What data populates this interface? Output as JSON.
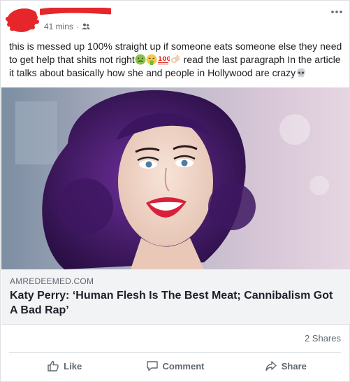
{
  "post": {
    "timestamp": "41 mins",
    "separator": "·",
    "privacy_icon": "friends-icon",
    "text_parts": {
      "part1": "this is messed up 100% straight up if someone eats someone else they need to get help that shits not right",
      "part2": " read the last paragraph In the article it talks about basically how she and people in Hollywood are crazy"
    },
    "emojis": [
      "nauseated-face-icon",
      "vomiting-face-icon",
      "hundred-points-icon",
      "ok-hand-icon",
      "skull-icon"
    ]
  },
  "link_preview": {
    "domain": "AMREDEEMED.COM",
    "title": "Katy Perry: ‘Human Flesh Is The Best Meat; Cannibalism Got A Bad Rap’"
  },
  "engagement": {
    "shares": "2 Shares"
  },
  "actions": {
    "like": "Like",
    "comment": "Comment",
    "share": "Share"
  },
  "colors": {
    "redaction": "#e5262a",
    "link_bg": "#f2f3f5",
    "muted_text": "#606770",
    "hair_purple": "#4b1f6e"
  }
}
